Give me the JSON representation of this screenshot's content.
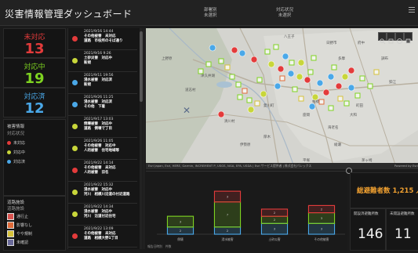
{
  "header": {
    "title": "災害情報管理ダッシュボード",
    "stat1_label": "部署別",
    "stat1_value": "未選択",
    "stat2_label": "対応状況",
    "stat2_value": "未選択"
  },
  "kpis": [
    {
      "label": "未対応",
      "value": "13",
      "color": "#e33b3b"
    },
    {
      "label": "対応中",
      "value": "19",
      "color": "#7ed321"
    },
    {
      "label": "対応済",
      "value": "12",
      "color": "#4aa8e8"
    }
  ],
  "status_panel": {
    "title": "被害情報",
    "subtitle": "対応状況",
    "items": [
      {
        "label": "未対応",
        "color": "#e33b3b"
      },
      {
        "label": "対応中",
        "color": "#c8d63a"
      },
      {
        "label": "対応済",
        "color": "#4aa8e8"
      }
    ]
  },
  "road_panel": {
    "title": "道路施設",
    "subtitle": "道路施設",
    "items": [
      {
        "label": "通行止",
        "icon": "road-closed-icon",
        "color": "#d9534f"
      },
      {
        "label": "影響なし",
        "icon": "road-ok-icon",
        "color": "#e06b3a"
      },
      {
        "label": "やや規制",
        "icon": "road-partial-icon",
        "color": "#d6c23a"
      },
      {
        "label": "未確認",
        "icon": "road-unknown-icon",
        "color": "#6a6a9a"
      }
    ]
  },
  "feed": [
    {
      "date": "2021/9/16 14:44",
      "status": "その他被害　未対応",
      "area": "道路　市役所のそば通り",
      "color": "#e33b3b"
    },
    {
      "date": "2021/9/16 9:26",
      "status": "土砂災害　対応中",
      "area": "新規",
      "color": "#c8d63a"
    },
    {
      "date": "2021/9/11 19:56",
      "status": "浸水被害　対応済",
      "area": "新規",
      "color": "#4aa8e8"
    },
    {
      "date": "2021/9/26 11:25",
      "status": "浸水被害　対応済",
      "area": "その他　下着",
      "color": "#4aa8e8"
    },
    {
      "date": "2021/9/17 13:03",
      "status": "倒壊被害　対応中",
      "area": "道路　倒壊で丁目",
      "color": "#c8d63a"
    },
    {
      "date": "2021/9/26 11:05",
      "status": "その他被害　対応中",
      "area": "人的被害　住宅地域等",
      "color": "#c8d63a"
    },
    {
      "date": "2021/9/22 14:14",
      "status": "その他被害　未対応",
      "area": "人的被害　旧名",
      "color": "#e33b3b"
    },
    {
      "date": "2021/9/22 15:32",
      "status": "浸水被害　対応中",
      "area": "河川　相模川沿道の付近道路",
      "color": "#c8d63a"
    },
    {
      "date": "2021/9/22 14:34",
      "status": "浸水被害　対応中",
      "area": "河川　沿道付近住宅",
      "color": "#c8d63a"
    },
    {
      "date": "2021/9/22 13:09",
      "status": "その他被害　未対応",
      "area": "道路　相模大野1丁目",
      "color": "#e33b3b"
    }
  ],
  "map": {
    "attribution": "Esri Japan, Esri, HERE, Garmin, INCREMENT P, USGS, NGA, EPA, USDA | Esri サービス提供者 | 株式会社パレックス",
    "powered": "Powered by Esri",
    "places": [
      "八王子",
      "多摩",
      "町田",
      "相模原",
      "厚木",
      "海老名",
      "大和",
      "座間",
      "綾瀬",
      "伊勢原",
      "平塚",
      "茅ヶ崎",
      "清川村",
      "愛川町",
      "上野原",
      "道志村",
      "津久井湖",
      "日野市",
      "府中",
      "調布",
      "狛江"
    ]
  },
  "chart_data": {
    "type": "bar",
    "categories": [
      "倒壊",
      "浸水被害",
      "土砂災害",
      "その他被害"
    ],
    "series": [
      {
        "name": "対応済",
        "color": "#4aa8e8",
        "values": [
          2,
          2,
          3,
          3
        ]
      },
      {
        "name": "対応中",
        "color": "#7ed321",
        "values": [
          3,
          7,
          2,
          3
        ]
      },
      {
        "name": "未対応",
        "color": "#e33b3b",
        "values": [
          0,
          3,
          2,
          2
        ]
      }
    ],
    "stack_labels": [
      "3",
      "7",
      "2"
    ],
    "ylim": [
      0,
      14
    ],
    "footer": "報告日時別　件数"
  },
  "total_evac": {
    "label": "総避難者数",
    "value": "1,215",
    "unit": "人"
  },
  "small_kpis": [
    {
      "label": "開設済避難所数",
      "value": "146"
    },
    {
      "label": "未開設避難所数",
      "value": "11"
    }
  ]
}
